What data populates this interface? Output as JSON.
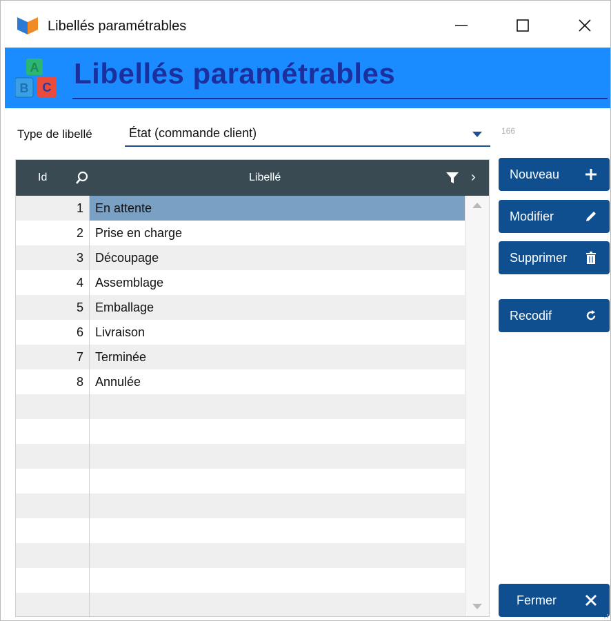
{
  "window": {
    "title": "Libellés paramétrables",
    "controls": {
      "minimize": "—",
      "maximize": "☐",
      "close": "✕"
    }
  },
  "header": {
    "title": "Libellés paramétrables",
    "icon_letters": {
      "a": "A",
      "b": "B",
      "c": "C"
    },
    "background": "#1a8cff",
    "title_color": "#1b2f9e"
  },
  "type_selector": {
    "label": "Type de libellé",
    "value": "État (commande client)",
    "count": "166"
  },
  "table": {
    "columns": {
      "id": "Id",
      "libelle": "Libellé"
    },
    "rows": [
      {
        "id": "1",
        "libelle": "En attente",
        "selected": true
      },
      {
        "id": "2",
        "libelle": "Prise en charge"
      },
      {
        "id": "3",
        "libelle": "Découpage"
      },
      {
        "id": "4",
        "libelle": "Assemblage"
      },
      {
        "id": "5",
        "libelle": "Emballage"
      },
      {
        "id": "6",
        "libelle": "Livraison"
      },
      {
        "id": "7",
        "libelle": "Terminée"
      },
      {
        "id": "8",
        "libelle": "Annulée"
      },
      {
        "id": "",
        "libelle": ""
      },
      {
        "id": "",
        "libelle": ""
      },
      {
        "id": "",
        "libelle": ""
      },
      {
        "id": "",
        "libelle": ""
      },
      {
        "id": "",
        "libelle": ""
      },
      {
        "id": "",
        "libelle": ""
      },
      {
        "id": "",
        "libelle": ""
      },
      {
        "id": "",
        "libelle": ""
      },
      {
        "id": "",
        "libelle": ""
      }
    ],
    "selected_color": "#7aa1c3",
    "header_color": "#3a4a52"
  },
  "buttons": {
    "new": {
      "label": "Nouveau",
      "icon": "plus-icon"
    },
    "edit": {
      "label": "Modifier",
      "icon": "pencil-icon"
    },
    "delete": {
      "label": "Supprimer",
      "icon": "trash-icon"
    },
    "recode": {
      "label": "Recodif",
      "icon": "refresh-icon"
    },
    "close": {
      "label": "Fermer",
      "icon": "close-icon"
    },
    "color": "#0f4f8f"
  }
}
